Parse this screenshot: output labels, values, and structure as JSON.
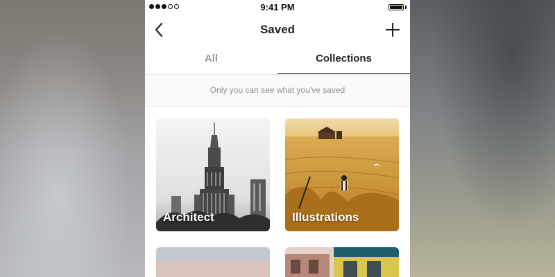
{
  "status_bar": {
    "time": "9:41 PM",
    "signal_filled": 3,
    "signal_total": 5
  },
  "nav": {
    "title": "Saved",
    "back_icon": "chevron-left-icon",
    "add_icon": "plus-icon"
  },
  "tabs": [
    {
      "label": "All",
      "active": false
    },
    {
      "label": "Collections",
      "active": true
    }
  ],
  "notice": "Only you can see what you've saved",
  "collections": [
    {
      "label": "Architect"
    },
    {
      "label": "Illustrations"
    },
    {
      "label": ""
    },
    {
      "label": ""
    }
  ],
  "colors": {
    "active_tab": "#262626",
    "inactive_tab": "#9a9a9a",
    "notice_text": "#8e8e8e"
  }
}
